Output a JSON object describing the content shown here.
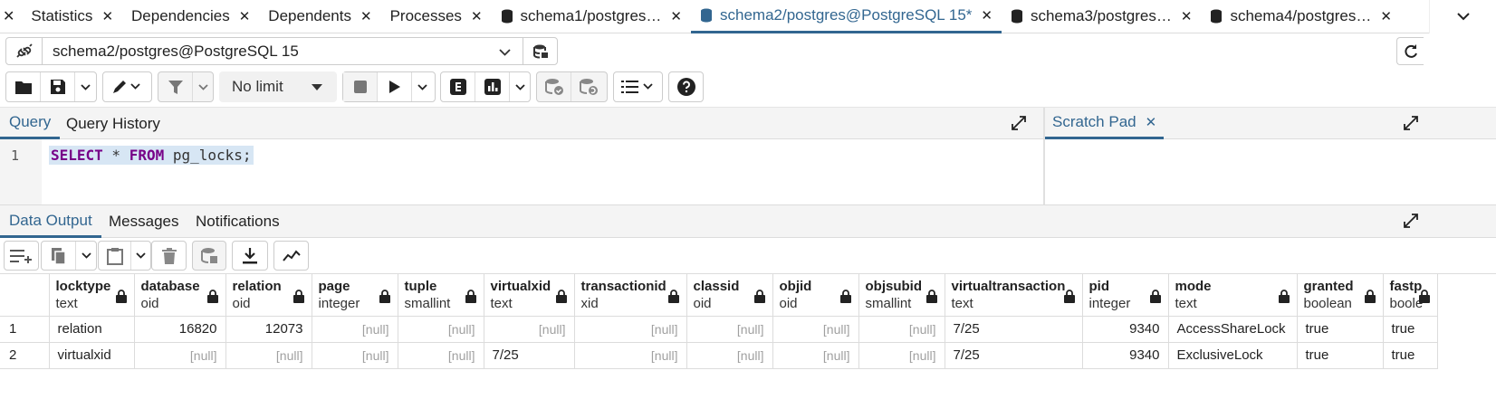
{
  "tabs": [
    {
      "label": "Statistics",
      "active": false,
      "db": false
    },
    {
      "label": "Dependencies",
      "active": false,
      "db": false
    },
    {
      "label": "Dependents",
      "active": false,
      "db": false
    },
    {
      "label": "Processes",
      "active": false,
      "db": false
    },
    {
      "label": "schema1/postgres…",
      "active": false,
      "db": true
    },
    {
      "label": "schema2/postgres@PostgreSQL 15*",
      "active": true,
      "db": true
    },
    {
      "label": "schema3/postgres…",
      "active": false,
      "db": true
    },
    {
      "label": "schema4/postgres…",
      "active": false,
      "db": true
    }
  ],
  "connection": {
    "label": "schema2/postgres@PostgreSQL 15"
  },
  "toolbar": {
    "limit": "No limit"
  },
  "query_tabs": {
    "query": "Query",
    "history": "Query History",
    "scratch": "Scratch Pad"
  },
  "editor": {
    "line": "1",
    "kw1": "SELECT",
    "mid": " * ",
    "kw2": "FROM",
    "rest": " pg_locks;"
  },
  "output_tabs": {
    "data": "Data Output",
    "messages": "Messages",
    "notifications": "Notifications"
  },
  "grid": {
    "columns": [
      {
        "name": "locktype",
        "type": "text"
      },
      {
        "name": "database",
        "type": "oid"
      },
      {
        "name": "relation",
        "type": "oid"
      },
      {
        "name": "page",
        "type": "integer"
      },
      {
        "name": "tuple",
        "type": "smallint"
      },
      {
        "name": "virtualxid",
        "type": "text"
      },
      {
        "name": "transactionid",
        "type": "xid"
      },
      {
        "name": "classid",
        "type": "oid"
      },
      {
        "name": "objid",
        "type": "oid"
      },
      {
        "name": "objsubid",
        "type": "smallint"
      },
      {
        "name": "virtualtransaction",
        "type": "text"
      },
      {
        "name": "pid",
        "type": "integer"
      },
      {
        "name": "mode",
        "type": "text"
      },
      {
        "name": "granted",
        "type": "boolean"
      },
      {
        "name": "fastp",
        "type": "boole"
      }
    ],
    "rows": [
      {
        "n": "1",
        "cells": [
          "relation",
          "16820",
          "12073",
          "[null]",
          "[null]",
          "[null]",
          "[null]",
          "[null]",
          "[null]",
          "[null]",
          "7/25",
          "9340",
          "AccessShareLock",
          "true",
          "true"
        ]
      },
      {
        "n": "2",
        "cells": [
          "virtualxid",
          "[null]",
          "[null]",
          "[null]",
          "[null]",
          "7/25",
          "[null]",
          "[null]",
          "[null]",
          "[null]",
          "7/25",
          "9340",
          "ExclusiveLock",
          "true",
          "true"
        ]
      }
    ]
  }
}
